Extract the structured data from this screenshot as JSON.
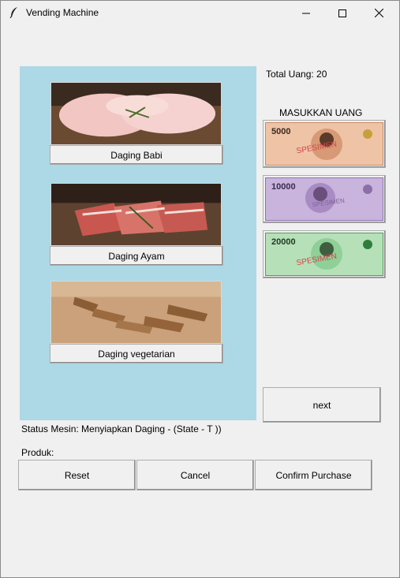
{
  "window": {
    "title": "Vending Machine",
    "icon": "feather-icon"
  },
  "products": [
    {
      "label": "Daging Babi",
      "image": "raw-pork-image"
    },
    {
      "label": "Daging Ayam",
      "image": "raw-meat-slices-image"
    },
    {
      "label": "Daging vegetarian",
      "image": "vegetarian-meat-image"
    }
  ],
  "money": {
    "total_label": "Total Uang: 20",
    "insert_label": "MASUKKAN UANG",
    "notes": [
      {
        "value_text": "5000",
        "overlay": "SPESIMEN",
        "color": "#e8a77c"
      },
      {
        "value_text": "10000",
        "overlay": "SPESIMEN",
        "color": "#a98bc4"
      },
      {
        "value_text": "20000",
        "overlay": "SPESIMEN",
        "color": "#6fbf7e"
      }
    ]
  },
  "controls": {
    "next_label": "next",
    "reset_label": "Reset",
    "cancel_label": "Cancel",
    "confirm_label": "Confirm Purchase"
  },
  "status": {
    "machine_status": "Status Mesin: Menyiapkan Daging - (State - T ))",
    "product_label": "Produk:"
  },
  "colors": {
    "panel_bg": "#add8e6",
    "window_bg": "#f0f0f0"
  }
}
